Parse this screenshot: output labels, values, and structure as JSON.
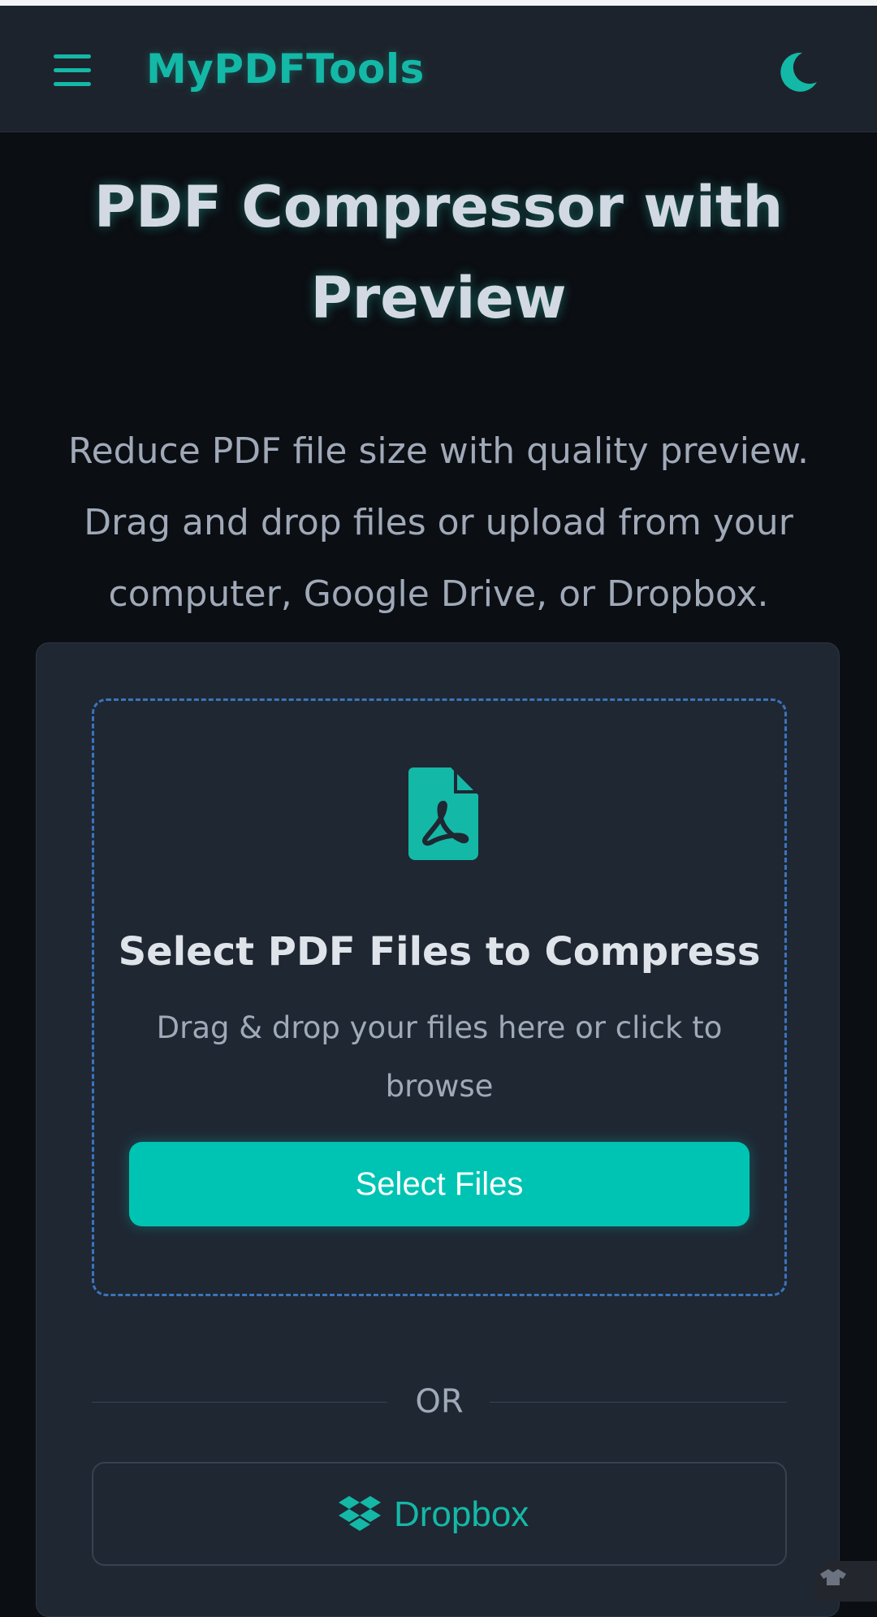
{
  "navbar": {
    "brand": "MyPDFTools",
    "menu_icon": "hamburger-menu-icon",
    "theme_icon": "moon-icon"
  },
  "hero": {
    "title": "PDF Compressor with Preview",
    "description": "Reduce PDF file size with quality preview. Drag and drop files or upload from your computer, Google Drive, or Dropbox."
  },
  "upload": {
    "icon": "file-pdf-icon",
    "title": "Select PDF Files to Compress",
    "subtitle": "Drag & drop your files here or click to browse",
    "button_label": "Select Files"
  },
  "divider": {
    "label": "OR"
  },
  "cloud": {
    "dropbox_icon": "dropbox-icon",
    "dropbox_label": "Dropbox"
  },
  "colors": {
    "accent": "#14b8a6",
    "button": "#00c4b3",
    "background": "#0b0e13",
    "navbar": "#1d232c",
    "card": "#1f2733",
    "dropzone_border": "#3b74bb"
  }
}
